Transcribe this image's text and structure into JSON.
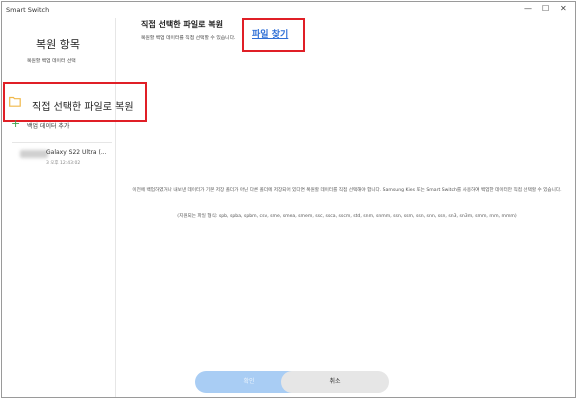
{
  "window": {
    "title": "Smart Switch"
  },
  "window_controls": {
    "minimize": "—",
    "maximize": "☐",
    "close": "✕"
  },
  "sidebar": {
    "title": "복원 항목",
    "subtitle": "복원할 백업 데이터 선택",
    "select_label": "직접 선택한 파일로 복원",
    "add_label": "백업 데이터 추가",
    "device": {
      "name": "Galaxy S22 Ultra (...",
      "date": "3 오후 12:43:02"
    }
  },
  "main": {
    "title": "직접 선택한 파일로 복원",
    "subtitle": "복원할 백업 데이터를 직접 선택할 수 있습니다.",
    "find_link": "파일 찾기",
    "info_line1": "이전에 백업하였거나 내보낸 데이터가 기본 저장 폴더가 아닌 다른 폴더에 저장되어 있다면 복원할 데이터를 직접 선택해야 합니다. Samsung Kies 또는 Smart Switch를 사용하여 백업한 데이터만 직접 선택할 수 있습니다.",
    "formats": "(지원되는 파일 형식: spb, spba, spbm, csv, sme, smea, smem, ssc, ssca, sscm, std, snm, snmm, ssn, ssm, ssn, snn, ssn, sn3, sn3m, smm, rnm, mmm)"
  },
  "buttons": {
    "ok": "확인",
    "cancel": "취소"
  },
  "colors": {
    "highlight": "#e01f26",
    "link": "#2f6fd6",
    "add_icon": "#3fa14f",
    "ok_button": "#a9cdf4",
    "folder": "#f0b84a"
  }
}
